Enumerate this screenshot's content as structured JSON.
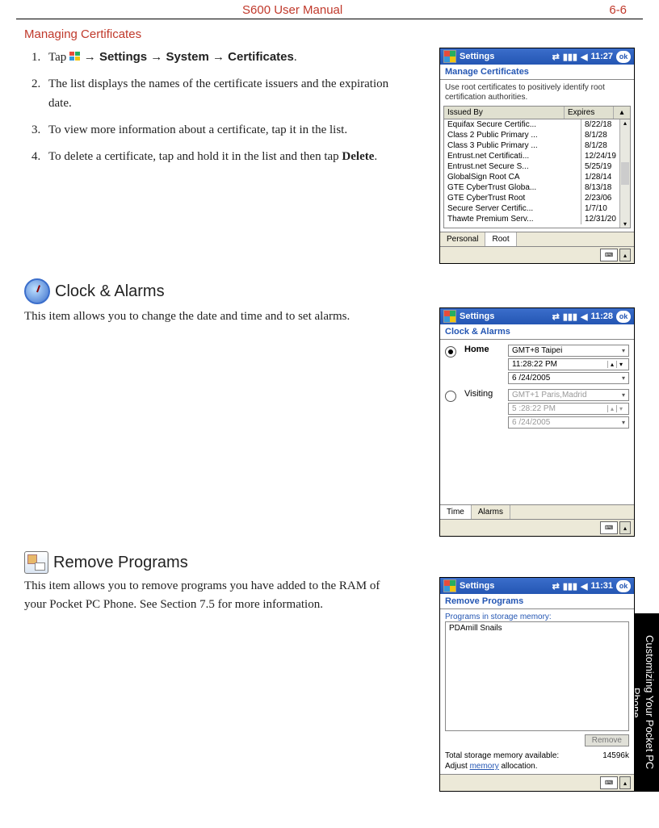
{
  "header": {
    "title": "S600 User Manual",
    "page": "6-6"
  },
  "sideTab": "Customizing Your\nPocket PC Phone",
  "sec1": {
    "title": "Managing Certificates",
    "steps": [
      {
        "pre": "Tap ",
        "path": " → Settings → System → Certificates",
        "post": "."
      },
      {
        "text": "The list displays the names of the certificate issuers and the expiration date."
      },
      {
        "text": "To view more information about a certificate, tap it in the list."
      },
      {
        "pre": "To delete a certificate, tap and hold it in the list and then tap ",
        "bold": "Delete",
        "post": "."
      }
    ],
    "shot": {
      "app": "Settings",
      "time": "11:27",
      "ok": "ok",
      "subtitle": "Manage Certificates",
      "desc": "Use root certificates to positively identify root certification authorities.",
      "colIssued": "Issued By",
      "colExp": "Expires",
      "rows": [
        [
          "Equifax Secure Certific...",
          "8/22/18"
        ],
        [
          "Class 2 Public Primary ...",
          "8/1/28"
        ],
        [
          "Class 3 Public Primary ...",
          "8/1/28"
        ],
        [
          "Entrust.net Certificati...",
          "12/24/19"
        ],
        [
          "Entrust.net Secure S...",
          "5/25/19"
        ],
        [
          "GlobalSign Root CA",
          "1/28/14"
        ],
        [
          "GTE CyberTrust Globa...",
          "8/13/18"
        ],
        [
          "GTE CyberTrust Root",
          "2/23/06"
        ],
        [
          "Secure Server Certific...",
          "1/7/10"
        ],
        [
          "Thawte Premium Serv...",
          "12/31/20"
        ]
      ],
      "tabs": [
        "Personal",
        "Root"
      ]
    }
  },
  "sec2": {
    "title": "Clock & Alarms",
    "text": "This item allows you to change the date and time and to set alarms.",
    "shot": {
      "app": "Settings",
      "time": "11:28",
      "ok": "ok",
      "subtitle": "Clock & Alarms",
      "homeLabel": "Home",
      "home": {
        "tz": "GMT+8 Taipei",
        "time": "11:28:22 PM",
        "date": "6 /24/2005"
      },
      "visitLabel": "Visiting",
      "visit": {
        "tz": "GMT+1 Paris,Madrid",
        "time": "5 :28:22 PM",
        "date": "6 /24/2005"
      },
      "tabs": [
        "Time",
        "Alarms"
      ]
    }
  },
  "sec3": {
    "title": "Remove Programs",
    "text": "This item allows you to remove programs you have added to the RAM of your Pocket PC Phone. See Section 7.5 for more information.",
    "shot": {
      "app": "Settings",
      "time": "11:31",
      "ok": "ok",
      "subtitle": "Remove Programs",
      "label": "Programs in storage memory:",
      "item": "PDAmill Snails",
      "removeBtn": "Remove",
      "memLabel": "Total storage memory available:",
      "memVal": "14596k",
      "adjustPre": "Adjust ",
      "adjustLink": "memory",
      "adjustPost": " allocation."
    }
  },
  "statusIcons": {
    "conn": "⇄",
    "sig": "▮▮▮",
    "spk": "◀"
  }
}
